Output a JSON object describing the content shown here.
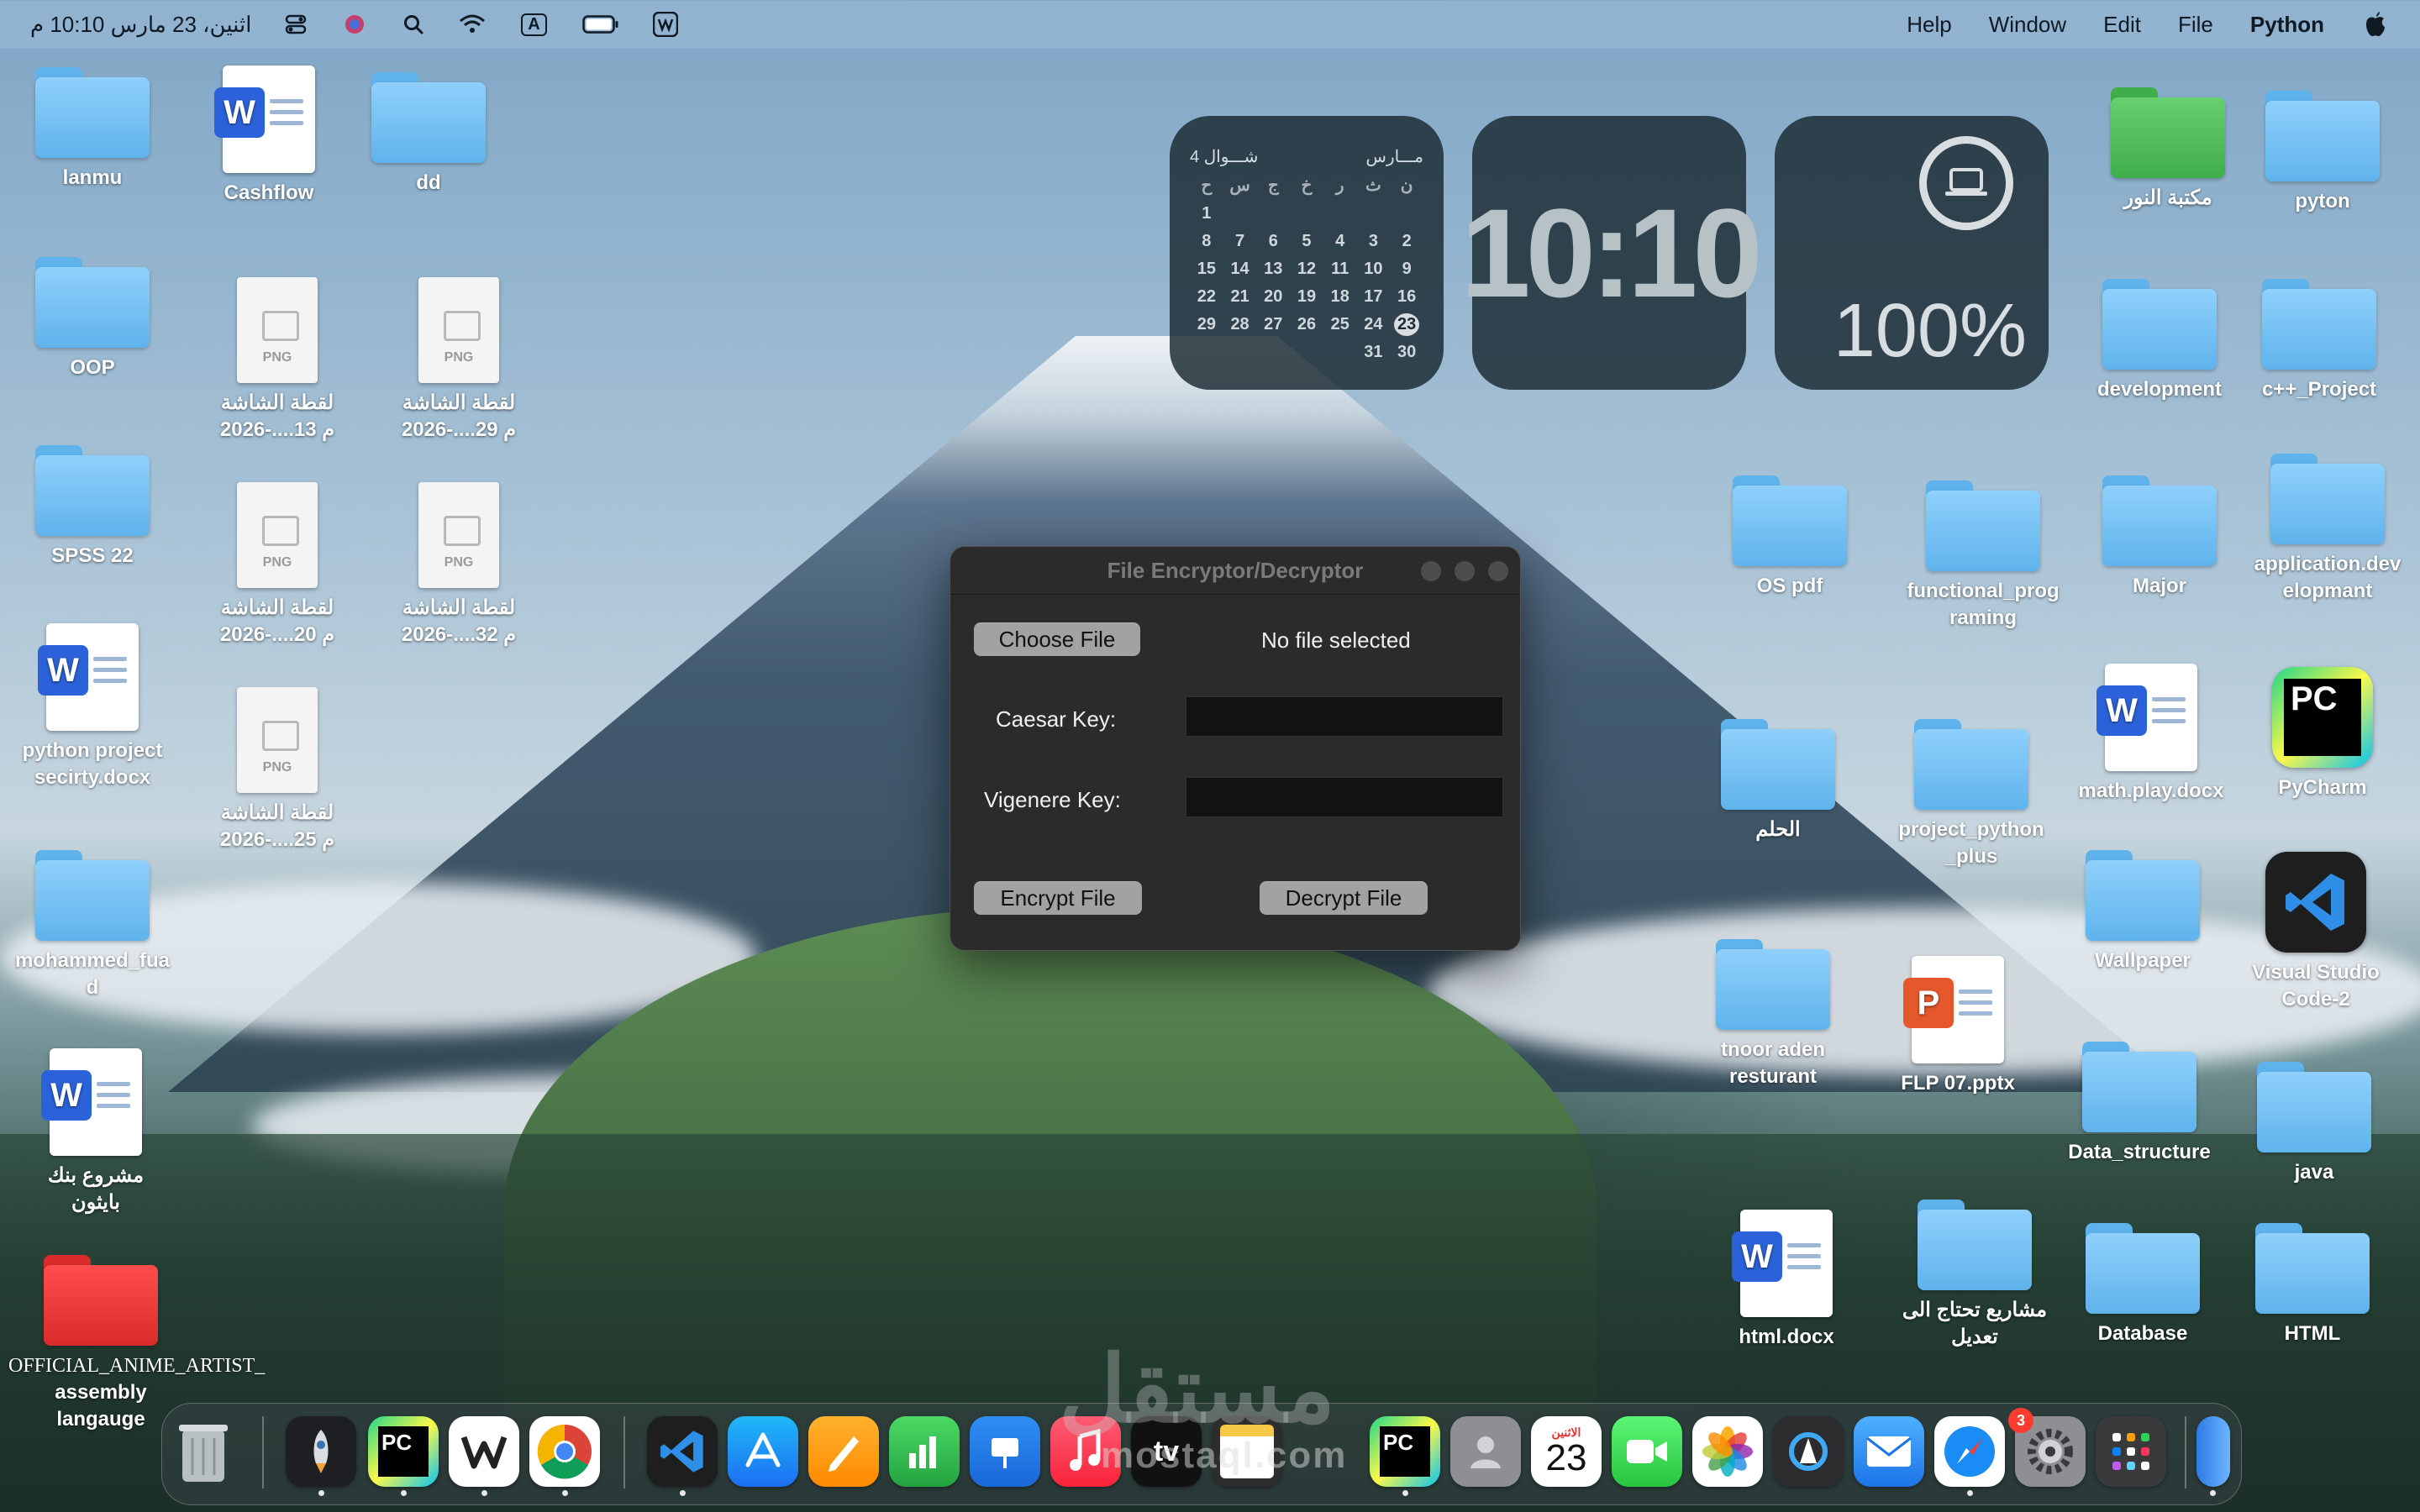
{
  "menubar": {
    "apple": "",
    "app_name": "Python",
    "menus": [
      "File",
      "Edit",
      "Window",
      "Help"
    ],
    "datetime": "اثنين، 23 مارس  10:10 م",
    "input_source": "A"
  },
  "widgets": {
    "calendar": {
      "gregorian_month": "مـــارس",
      "hijri_month": "4 شـــوال",
      "weekdays": [
        "ن",
        "ث",
        "ر",
        "خ",
        "ج",
        "س",
        "ح"
      ],
      "rows": [
        [
          "",
          "",
          "",
          "",
          "",
          "",
          "1"
        ],
        [
          "2",
          "3",
          "4",
          "5",
          "6",
          "7",
          "8"
        ],
        [
          "9",
          "10",
          "11",
          "12",
          "13",
          "14",
          "15"
        ],
        [
          "16",
          "17",
          "18",
          "19",
          "20",
          "21",
          "22"
        ],
        [
          "23",
          "24",
          "25",
          "26",
          "27",
          "28",
          "29"
        ],
        [
          "30",
          "31",
          "",
          "",
          "",
          "",
          ""
        ]
      ],
      "today": "23"
    },
    "clock": "10:10",
    "battery": "100%"
  },
  "window": {
    "title": "File Encryptor/Decryptor",
    "choose_file": "Choose File",
    "no_file": "No file selected",
    "caesar_label": "Caesar Key:",
    "vigenere_label": "Vigenere Key:",
    "caesar_value": "",
    "vigenere_value": "",
    "encrypt": "Encrypt File",
    "decrypt": "Decrypt File"
  },
  "desktop": {
    "lanmu": "lanmu",
    "cashflow": "Cashflow",
    "dd": "dd",
    "oop": "OOP",
    "spss": "SPSS 22",
    "python_doc_1": "python project",
    "python_doc_2": "secirty.docx",
    "mohammed_1": "mohammed_fua",
    "mohammed_2": "d",
    "bank_1": "مشروع بنك",
    "bank_2": "بايثون",
    "anime_1": "OFFICIAL_ANIME_ARTIST_",
    "anime_2": "assembly",
    "anime_3": "langauge",
    "shot_13_1": "لقطة الشاشة",
    "shot_13_2": "2026-....13 م",
    "shot_29_1": "لقطة الشاشة",
    "shot_29_2": "2026-....29 م",
    "shot_20_1": "لقطة الشاشة",
    "shot_20_2": "2026-....20 م",
    "shot_32_1": "لقطة الشاشة",
    "shot_32_2": "2026-....32 م",
    "shot_25_1": "لقطة الشاشة",
    "shot_25_2": "2026-....25 م",
    "png_ext": "PNG",
    "maktaba": "مكتبة النور",
    "pyton": "pyton",
    "development": "development",
    "cpp": "c++_Project",
    "ospdf": "OS pdf",
    "func_1": "functional_prog",
    "func_2": "raming",
    "major": "Major",
    "appdev_1": "application.dev",
    "appdev_2": "elopmant",
    "mathplay": "math.play.docx",
    "pycharm": "PyCharm",
    "alhulm": "الحلم",
    "pplus_1": "project_python",
    "pplus_2": "_plus",
    "wallpaper": "Wallpaper",
    "vscode_1": "Visual Studio",
    "vscode_2": "Code-2",
    "tnoor_1": "tnoor aden",
    "tnoor_2": "resturant",
    "flp": "FLP 07.pptx",
    "datastruct": "Data_structure",
    "java": "java",
    "htmldocx": "html.docx",
    "mashari_1": "مشاريع تحتاج الى",
    "mashari_2": "تعديل",
    "database": "Database",
    "html": "HTML",
    "word_badge": "W",
    "pc_badge": "PC",
    "ppt_badge": "P"
  },
  "dock": {
    "calendar_day": "23",
    "calendar_weekday": "الاثنين",
    "settings_badge": "3",
    "tv": "tv",
    "watermark": "مستقل",
    "watermark_sub": "mostaql.com"
  }
}
